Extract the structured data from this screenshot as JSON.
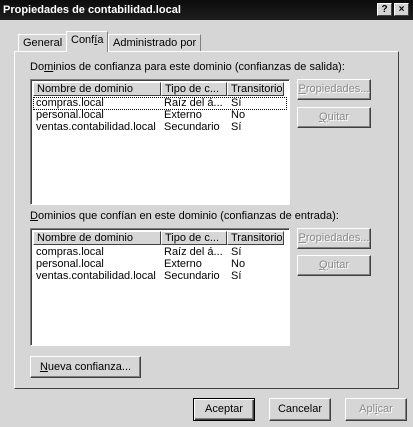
{
  "window": {
    "title": "Propiedades de contabilidad.local",
    "help_glyph": "?",
    "close_glyph": "×"
  },
  "tabs": [
    {
      "label": "General"
    },
    {
      "pre": "Conf",
      "ul": "í",
      "post": "a"
    },
    {
      "label": "Administrado por"
    }
  ],
  "outgoing": {
    "label_pre": "Do",
    "label_ul": "m",
    "label_post": "inios de confianza para este dominio (confianzas de salida):",
    "columns": [
      "Nombre de dominio",
      "Tipo de c...",
      "Transitorio"
    ],
    "rows": [
      [
        "compras.local",
        "Raíz del á...",
        "Sí"
      ],
      [
        "personal.local",
        "Externo",
        "No"
      ],
      [
        "ventas.contabilidad.local",
        "Secundario",
        "Sí"
      ]
    ],
    "properties": {
      "ul": "P",
      "post": "ropiedades..."
    },
    "remove": {
      "ul": "Q",
      "post": "uitar"
    }
  },
  "incoming": {
    "label_pre": "",
    "label_ul": "D",
    "label_post": "ominios que confían en este dominio (confianzas de entrada):",
    "columns": [
      "Nombre de dominio",
      "Tipo de c...",
      "Transitorio"
    ],
    "rows": [
      [
        "compras.local",
        "Raíz del á...",
        "Sí"
      ],
      [
        "personal.local",
        "Externo",
        "No"
      ],
      [
        "ventas.contabilidad.local",
        "Secundario",
        "Sí"
      ]
    ],
    "properties": {
      "ul": "P",
      "post": "ropiedades..."
    },
    "remove": {
      "ul": "Q",
      "post": "uitar"
    }
  },
  "new_trust": {
    "ul": "N",
    "post": "ueva confianza..."
  },
  "footer": {
    "accept": "Aceptar",
    "cancel": "Cancelar",
    "apply": {
      "pre": "Apl",
      "ul": "i",
      "post": "car"
    }
  }
}
